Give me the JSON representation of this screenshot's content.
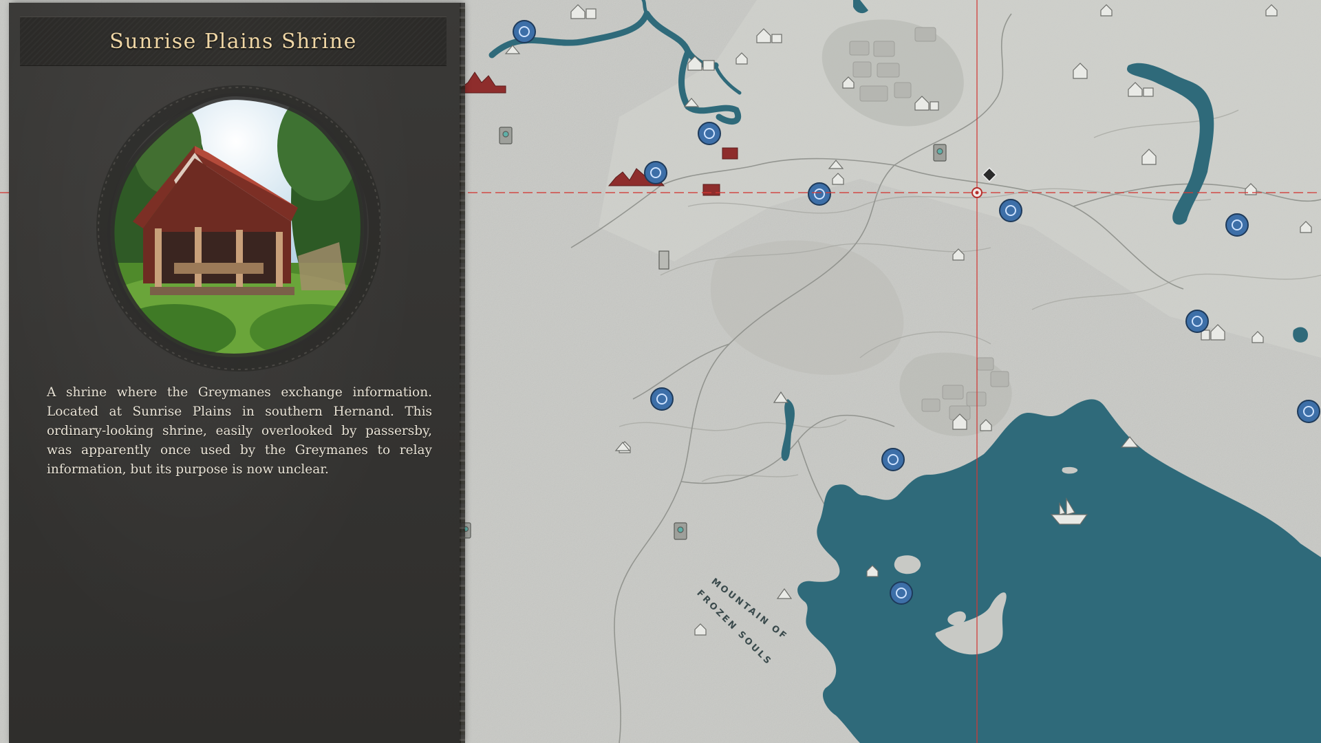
{
  "location_panel": {
    "title": "Sunrise Plains Shrine",
    "description": "A shrine where the Greymanes exchange information. Located at Sunrise Plains in southern Hernand. This ordinary-looking shrine, easily overlooked by passersby, was apparently once used by the Greymanes to relay information, but its purpose is now unclear.",
    "preview_image": "shrine-illustration"
  },
  "map": {
    "region_labels": {
      "line1": "MOUNTAIN OF",
      "line2": "FROZEN SOULS"
    },
    "colors": {
      "land": "#c9cac6",
      "water": "#2f6a7a",
      "crosshair": "#d23a36",
      "fast_travel": "#3d6fa8",
      "red_landmark": "#8e2d2c"
    },
    "icons": {
      "fast_travel": "fast-travel-icon",
      "camp": "camp-icon",
      "house": "house-icon",
      "tower": "tower-icon",
      "castle": "castle-icon",
      "shrine_marker": "shrine-marker-icon",
      "ship": "ship-icon",
      "cursor": "map-cursor-icon"
    }
  }
}
